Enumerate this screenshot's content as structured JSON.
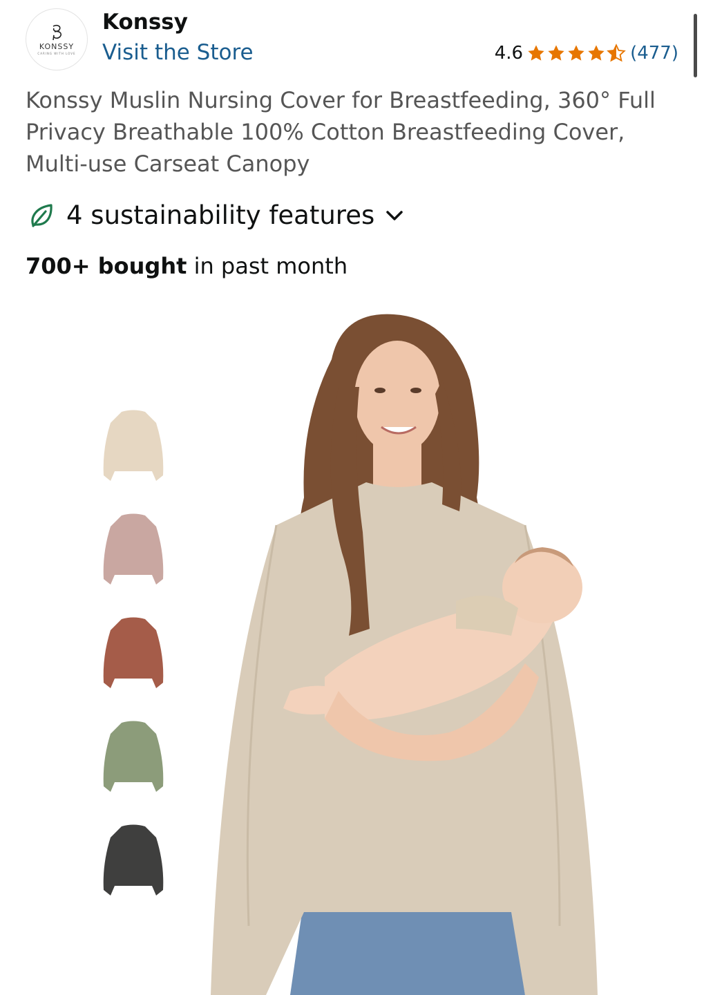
{
  "store": {
    "logo_text": "KONSSY",
    "logo_tagline": "CARING WITH LOVE",
    "brand_name": "Konssy",
    "visit_label": "Visit the Store"
  },
  "rating": {
    "value": "4.6",
    "stars_out_of_5": 4.6,
    "count_label": "(477)",
    "star_color": "#e77600",
    "link_color": "#1a5d8f"
  },
  "product": {
    "title": "Konssy Muslin Nursing Cover for Breastfeeding, 360° Full Privacy Breathable 100% Cotton Breastfeeding Cover, Multi-use Carseat Canopy"
  },
  "sustainability": {
    "label": "4 sustainability features",
    "icon": "leaf-icon",
    "icon_color": "#1f7a4d",
    "chevron_icon": "chevron-down-icon"
  },
  "social_proof": {
    "bought_strong": "700+ bought",
    "bought_rest": " in past month"
  },
  "color_swatches": [
    {
      "name": "beige",
      "color": "#e6d7c2"
    },
    {
      "name": "pink",
      "color": "#c9a7a1"
    },
    {
      "name": "rust",
      "color": "#a55c49"
    },
    {
      "name": "sage",
      "color": "#8c9c7a"
    },
    {
      "name": "charcoal",
      "color": "#3f3f3e"
    }
  ],
  "hero_image": {
    "poncho_color": "#d9ccb9",
    "jeans_color": "#6f8fb4",
    "hair_color": "#7a4f33",
    "skin_color": "#efc6ab"
  }
}
